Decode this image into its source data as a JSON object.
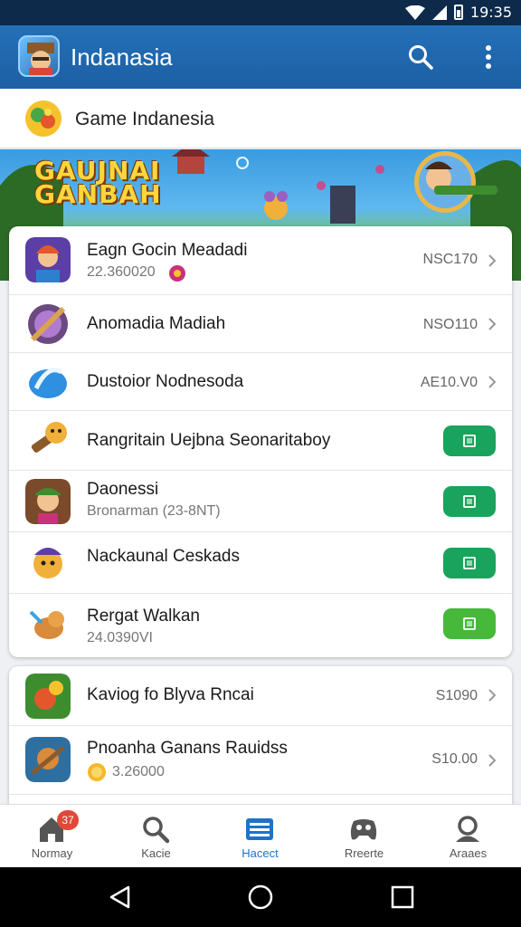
{
  "status_bar": {
    "time": "19:35"
  },
  "app_bar": {
    "title": "Indanasia",
    "search_icon": "search-icon",
    "menu_icon": "more-vert-icon"
  },
  "subheader": {
    "title": "Game Indanesia"
  },
  "banner": {
    "logo_line1": "GAUJNAI",
    "logo_line2": "GANBAH"
  },
  "list_primary": [
    {
      "title": "Eagn Gocin Meadadi",
      "subtitle": "22.360020",
      "price": "NSC170",
      "action": "chevron"
    },
    {
      "title": "Anomadia Madiah",
      "subtitle": "",
      "price": "NSO110",
      "action": "chevron"
    },
    {
      "title": "Dustoior Nodnesoda",
      "subtitle": "",
      "price": "AE10.V0",
      "action": "chevron"
    },
    {
      "title": "Rangritain Uejbna Seonaritaboy",
      "subtitle": "",
      "price": "",
      "action": "install"
    },
    {
      "title": "Daonessi",
      "subtitle": "Bronarman (23-8NT)",
      "price": "",
      "action": "install"
    },
    {
      "title": "Nackaunal Ceskads",
      "subtitle": "",
      "price": "",
      "action": "install"
    },
    {
      "title": "Rergat Walkan",
      "subtitle": "24.0390VI",
      "price": "",
      "action": "install"
    }
  ],
  "list_secondary": [
    {
      "title": "Kaviog fo Blyva Rncai",
      "subtitle": "",
      "price": "S1090",
      "action": "chevron"
    },
    {
      "title": "Pnoanha Ganans Rauidss",
      "subtitle": "3.26000",
      "price": "S10.00",
      "action": "chevron"
    }
  ],
  "bottom_nav": [
    {
      "label": "Normay",
      "icon": "home-icon",
      "badge": "37"
    },
    {
      "label": "Kacie",
      "icon": "search-icon",
      "badge": ""
    },
    {
      "label": "Hacect",
      "icon": "list-icon",
      "badge": ""
    },
    {
      "label": "Rreerte",
      "icon": "gamepad-icon",
      "badge": ""
    },
    {
      "label": "Araaes",
      "icon": "profile-icon",
      "badge": ""
    }
  ],
  "colors": {
    "app_bar": "#1f66ac",
    "install_green": "#1aa35c",
    "active_tab": "#1e73c8",
    "badge": "#e0483a"
  }
}
